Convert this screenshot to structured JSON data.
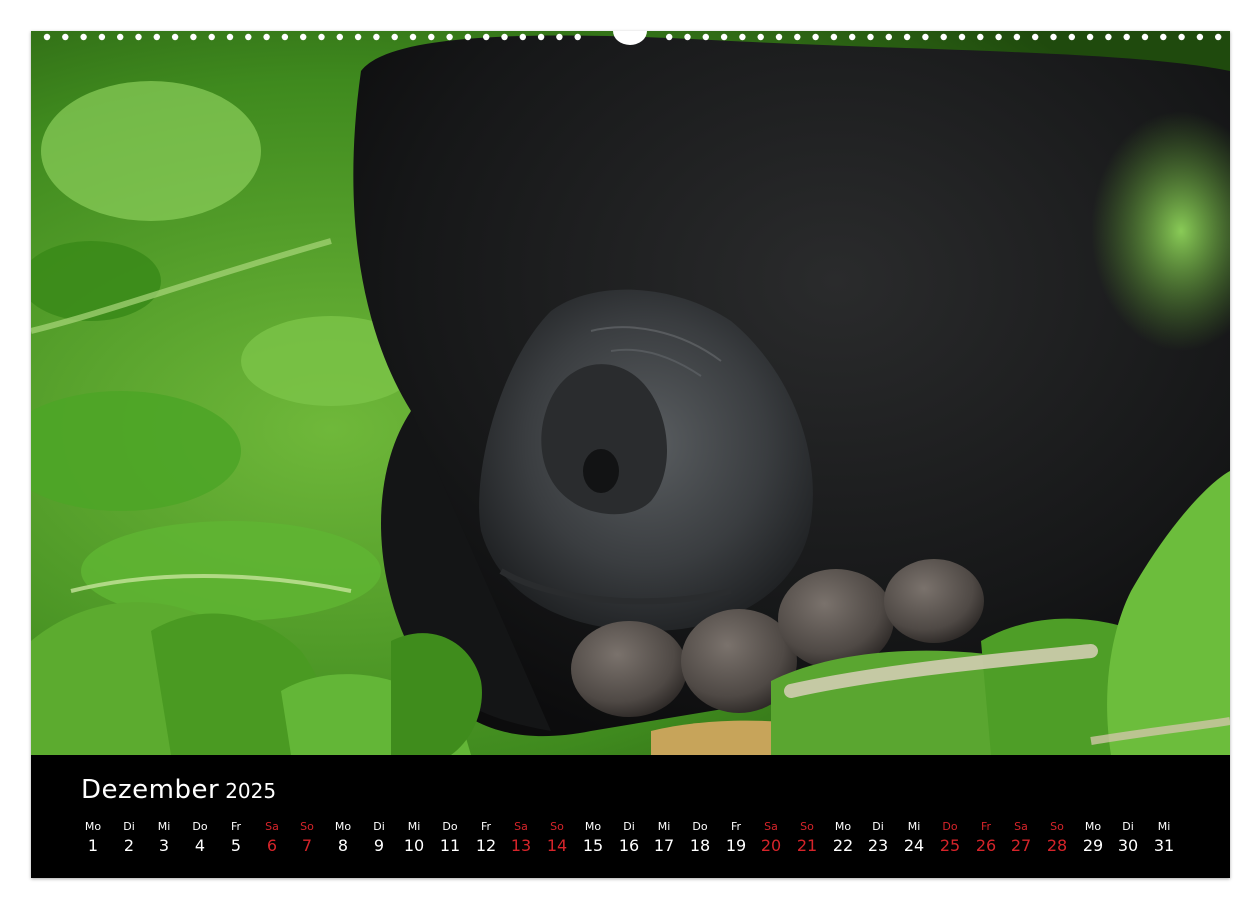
{
  "calendar": {
    "month": "Dezember",
    "year": "2025",
    "red_color": "#d6242a",
    "days": [
      {
        "wd": "Mo",
        "n": "1",
        "red": false
      },
      {
        "wd": "Di",
        "n": "2",
        "red": false
      },
      {
        "wd": "Mi",
        "n": "3",
        "red": false
      },
      {
        "wd": "Do",
        "n": "4",
        "red": false
      },
      {
        "wd": "Fr",
        "n": "5",
        "red": false
      },
      {
        "wd": "Sa",
        "n": "6",
        "red": true
      },
      {
        "wd": "So",
        "n": "7",
        "red": true
      },
      {
        "wd": "Mo",
        "n": "8",
        "red": false
      },
      {
        "wd": "Di",
        "n": "9",
        "red": false
      },
      {
        "wd": "Mi",
        "n": "10",
        "red": false
      },
      {
        "wd": "Do",
        "n": "11",
        "red": false
      },
      {
        "wd": "Fr",
        "n": "12",
        "red": false
      },
      {
        "wd": "Sa",
        "n": "13",
        "red": true
      },
      {
        "wd": "So",
        "n": "14",
        "red": true
      },
      {
        "wd": "Mo",
        "n": "15",
        "red": false
      },
      {
        "wd": "Di",
        "n": "16",
        "red": false
      },
      {
        "wd": "Mi",
        "n": "17",
        "red": false
      },
      {
        "wd": "Do",
        "n": "18",
        "red": false
      },
      {
        "wd": "Fr",
        "n": "19",
        "red": false
      },
      {
        "wd": "Sa",
        "n": "20",
        "red": true
      },
      {
        "wd": "So",
        "n": "21",
        "red": true
      },
      {
        "wd": "Mo",
        "n": "22",
        "red": false
      },
      {
        "wd": "Di",
        "n": "23",
        "red": false
      },
      {
        "wd": "Mi",
        "n": "24",
        "red": false
      },
      {
        "wd": "Do",
        "n": "25",
        "red": true
      },
      {
        "wd": "Fr",
        "n": "26",
        "red": true
      },
      {
        "wd": "Sa",
        "n": "27",
        "red": true
      },
      {
        "wd": "So",
        "n": "28",
        "red": true
      },
      {
        "wd": "Mo",
        "n": "29",
        "red": false
      },
      {
        "wd": "Di",
        "n": "30",
        "red": false
      },
      {
        "wd": "Mi",
        "n": "31",
        "red": false
      }
    ]
  }
}
